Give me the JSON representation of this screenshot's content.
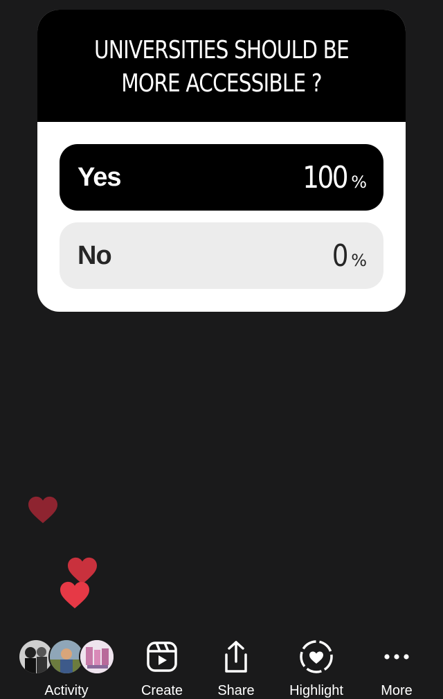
{
  "poll": {
    "question_line1": "UNIVERSITIES SHOULD BE",
    "question_line2": "MORE ACCESSIBLE ?",
    "options": [
      {
        "label": "Yes",
        "percent": "100",
        "percent_sign": "%",
        "selected": true
      },
      {
        "label": "No",
        "percent": "0",
        "percent_sign": "%",
        "selected": false
      }
    ]
  },
  "reactions": {
    "icon": "heart-icon",
    "colors": [
      "#8e2430",
      "#c9313d",
      "#e63946"
    ]
  },
  "bottom_bar": {
    "viewers_label": "Activity",
    "create_label": "Create",
    "share_label": "Share",
    "highlight_label": "Highlight",
    "more_label": "More",
    "icons": {
      "create": "reels-icon",
      "share": "share-icon",
      "highlight": "highlight-heart-icon",
      "more": "more-dots-icon"
    }
  }
}
